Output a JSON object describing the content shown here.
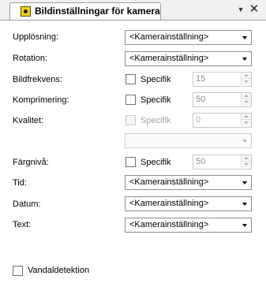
{
  "tab": {
    "title": "Bildinställningar för kamera",
    "icon": "camera-icon"
  },
  "controls": {
    "pin_glyph": "▼",
    "close_glyph": "✕"
  },
  "rows": {
    "upplosning": {
      "label": "Upplösning:",
      "value": "<Kamerainställning>"
    },
    "rotation": {
      "label": "Rotation:",
      "value": "<Kamerainställning>"
    },
    "bildfrekvens": {
      "label": "Bildfrekvens:",
      "checkbox_label": "Specifik",
      "checked": false,
      "value": "15"
    },
    "komprimering": {
      "label": "Komprimering:",
      "checkbox_label": "Specifik",
      "checked": false,
      "value": "50"
    },
    "kvalitet": {
      "label": "Kvalitet:",
      "checkbox_label": "Specifik",
      "checked": false,
      "value": "0",
      "disabled": true,
      "dropdown_value": ""
    },
    "fargniva": {
      "label": "Färgnivå:",
      "checkbox_label": "Specifik",
      "checked": false,
      "value": "50"
    },
    "tid": {
      "label": "Tid:",
      "value": "<Kamerainställning>"
    },
    "datum": {
      "label": "Datum:",
      "value": "<Kamerainställning>"
    },
    "text": {
      "label": "Text:",
      "value": "<Kamerainställning>"
    }
  },
  "vandal": {
    "label": "Vandaldetektion",
    "checked": false
  }
}
